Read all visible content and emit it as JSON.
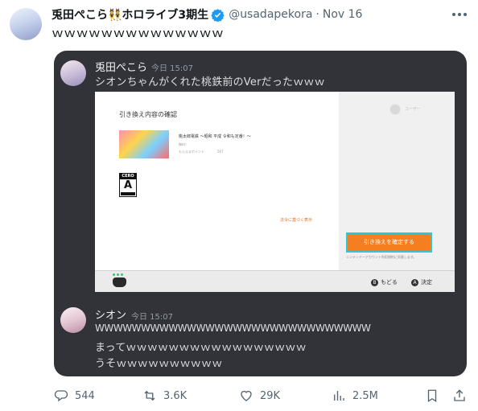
{
  "tweet": {
    "author_name": "兎田ぺこら👯ホロライブ3期生",
    "handle": "@usadapekora",
    "separator": "·",
    "date": "Nov 16",
    "text": "ｗｗｗｗｗｗｗｗｗｗｗｗｗｗ"
  },
  "discord": {
    "message1": {
      "username": "兎田ぺこら",
      "time": "今日 15:07",
      "text": "シオンちゃんがくれた桃鉄前のVerだったｗｗｗ"
    },
    "switch_screen": {
      "title": "引き換え内容の確認",
      "game_name": "桃太郎電鉄 〜昭和 平成 令和も定番！〜",
      "price_label": "無料！",
      "points_label": "もらえるポイント",
      "points_value": "567",
      "cero_top": "CERO",
      "cero_rating": "A",
      "link_text": "法令に基づく表示",
      "user_label": "ユーザー",
      "confirm_button": "引き換えを確定する",
      "note_text": "ニンテンドーアカウント利用規約に同意します。",
      "back_label": "もどる",
      "back_key": "B",
      "decide_label": "決定",
      "decide_key": "A"
    },
    "message2": {
      "username": "シオン",
      "time": "今日 15:07",
      "lines": [
        "WWWWWWWWWWWWWWWWWWWWWWWWWWWWWW",
        "まってｗｗｗｗｗｗｗｗｗｗｗｗｗｗｗｗｗ",
        "うそｗｗｗｗｗｗｗｗｗｗ"
      ]
    }
  },
  "actions": {
    "replies": "544",
    "reposts": "3.6K",
    "likes": "29K",
    "views": "2.5M"
  },
  "icons": {
    "verified": "verified-badge-icon",
    "more": "more-icon",
    "reply": "reply-icon",
    "repost": "repost-icon",
    "like": "heart-icon",
    "views": "views-icon",
    "bookmark": "bookmark-icon",
    "share": "share-icon"
  },
  "colors": {
    "verified": "#1d9bf0",
    "discord_bg": "#313338",
    "confirm_button": "#f57e20",
    "confirm_border": "#35c6d2"
  }
}
